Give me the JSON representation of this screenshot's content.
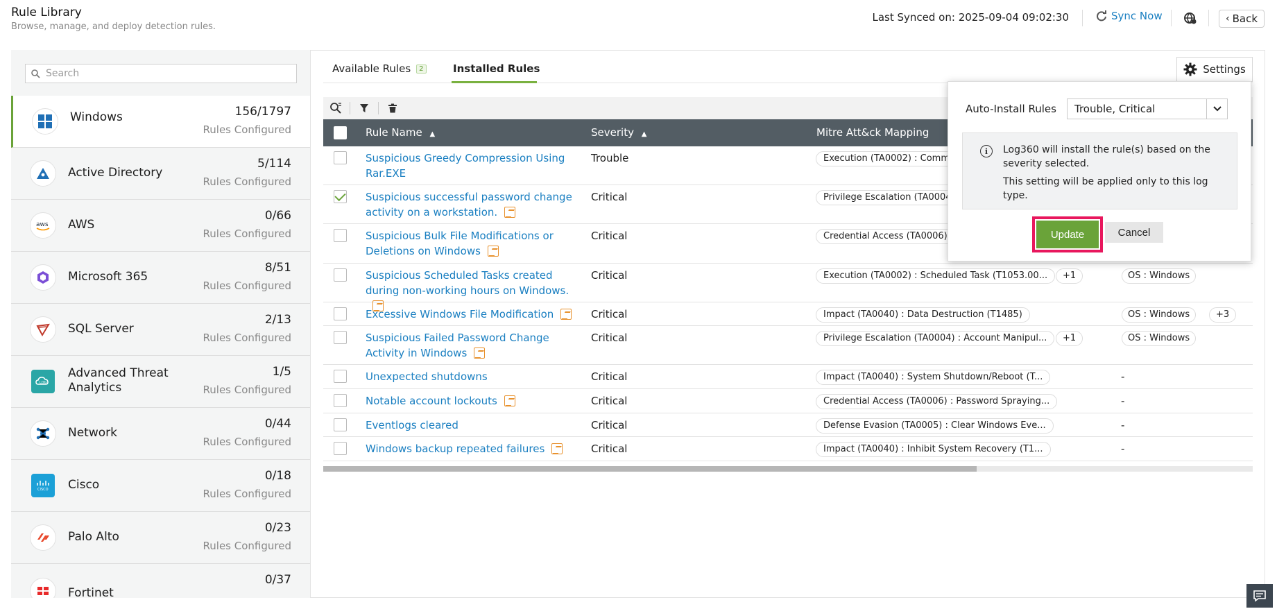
{
  "header": {
    "title": "Rule Library",
    "subtitle": "Browse, manage, and deploy detection rules.",
    "last_synced": "Last Synced on: 2025-09-04 09:02:30",
    "sync_now": "Sync Now",
    "back": "Back"
  },
  "sidebar": {
    "search_placeholder": "Search",
    "items": [
      {
        "name": "Windows",
        "count": "156/1797",
        "sub": "Rules Configured",
        "icon": "windows-icon"
      },
      {
        "name": "Active Directory",
        "count": "5/114",
        "sub": "Rules Configured",
        "icon": "active-directory-icon"
      },
      {
        "name": "AWS",
        "count": "0/66",
        "sub": "Rules Configured",
        "icon": "aws-icon"
      },
      {
        "name": "Microsoft 365",
        "count": "8/51",
        "sub": "Rules Configured",
        "icon": "microsoft-365-icon"
      },
      {
        "name": "SQL Server",
        "count": "2/13",
        "sub": "Rules Configured",
        "icon": "sql-server-icon"
      },
      {
        "name": "Advanced Threat Analytics",
        "count": "1/5",
        "sub": "Rules Configured",
        "icon": "ata-icon"
      },
      {
        "name": "Network",
        "count": "0/44",
        "sub": "Rules Configured",
        "icon": "network-icon"
      },
      {
        "name": "Cisco",
        "count": "0/18",
        "sub": "Rules Configured",
        "icon": "cisco-icon"
      },
      {
        "name": "Palo Alto",
        "count": "0/23",
        "sub": "Rules Configured",
        "icon": "palo-alto-icon"
      },
      {
        "name": "Fortinet",
        "count": "0/37",
        "sub": "Rules Configured",
        "icon": "fortinet-icon"
      }
    ]
  },
  "tabs": {
    "available": "Available Rules",
    "available_badge": "2",
    "installed": "Installed Rules",
    "settings": "Settings"
  },
  "table": {
    "columns": {
      "rule_name": "Rule Name",
      "severity": "Severity",
      "mitre": "Mitre Att&ck Mapping"
    },
    "rows": [
      {
        "name": "Suspicious Greedy Compression Using Rar.EXE",
        "severity": "Trouble",
        "mitre": "Execution (TA0002) : Comm",
        "plus": "",
        "os": "",
        "checked": false
      },
      {
        "name": "Suspicious successful password change activity on a workstation.",
        "severity": "Critical",
        "mitre": "Privilege Escalation (TA0004",
        "plus": "",
        "os": "",
        "checked": true
      },
      {
        "name": "Suspicious Bulk File Modifications or Deletions on Windows",
        "severity": "Critical",
        "mitre": "Credential Access (TA0006)",
        "plus": "",
        "os": "",
        "checked": false
      },
      {
        "name": "Suspicious Scheduled Tasks created during non-working hours on Windows.",
        "severity": "Critical",
        "mitre": "Execution (TA0002) : Scheduled Task (T1053.00...",
        "plus": "+1",
        "os": "OS : Windows",
        "checked": false
      },
      {
        "name": "Excessive Windows File Modification",
        "severity": "Critical",
        "mitre": "Impact (TA0040) : Data Destruction (T1485)",
        "plus": "",
        "os": "OS : Windows",
        "os_plus": "+3",
        "checked": false
      },
      {
        "name": "Suspicious Failed Password Change Activity in Windows",
        "severity": "Critical",
        "mitre": "Privilege Escalation (TA0004) : Account Manipul...",
        "plus": "+1",
        "os": "OS : Windows",
        "checked": false
      },
      {
        "name": "Unexpected shutdowns",
        "severity": "Critical",
        "mitre": "Impact (TA0040) : System Shutdown/Reboot (T...",
        "plus": "",
        "os": "-",
        "checked": false
      },
      {
        "name": "Notable account lockouts",
        "severity": "Critical",
        "mitre": "Credential Access (TA0006) : Password Spraying...",
        "plus": "",
        "os": "-",
        "checked": false
      },
      {
        "name": "Eventlogs cleared",
        "severity": "Critical",
        "mitre": "Defense Evasion (TA0005) : Clear Windows Eve...",
        "plus": "",
        "os": "-",
        "checked": false
      },
      {
        "name": "Windows backup repeated failures",
        "severity": "Critical",
        "mitre": "Impact (TA0040) : Inhibit System Recovery (T1...",
        "plus": "",
        "os": "-",
        "checked": false
      }
    ]
  },
  "popover": {
    "label": "Auto-Install Rules",
    "selected": "Trouble, Critical",
    "info_line1": "Log360 will install the rule(s) based on the severity selected.",
    "info_line2": "This setting will be applied only to this log type.",
    "update": "Update",
    "cancel": "Cancel"
  },
  "colors": {
    "accent_green": "#6aa339",
    "link_blue": "#1a7fc1",
    "highlight_pink": "#e8175d",
    "table_header": "#535d64"
  }
}
